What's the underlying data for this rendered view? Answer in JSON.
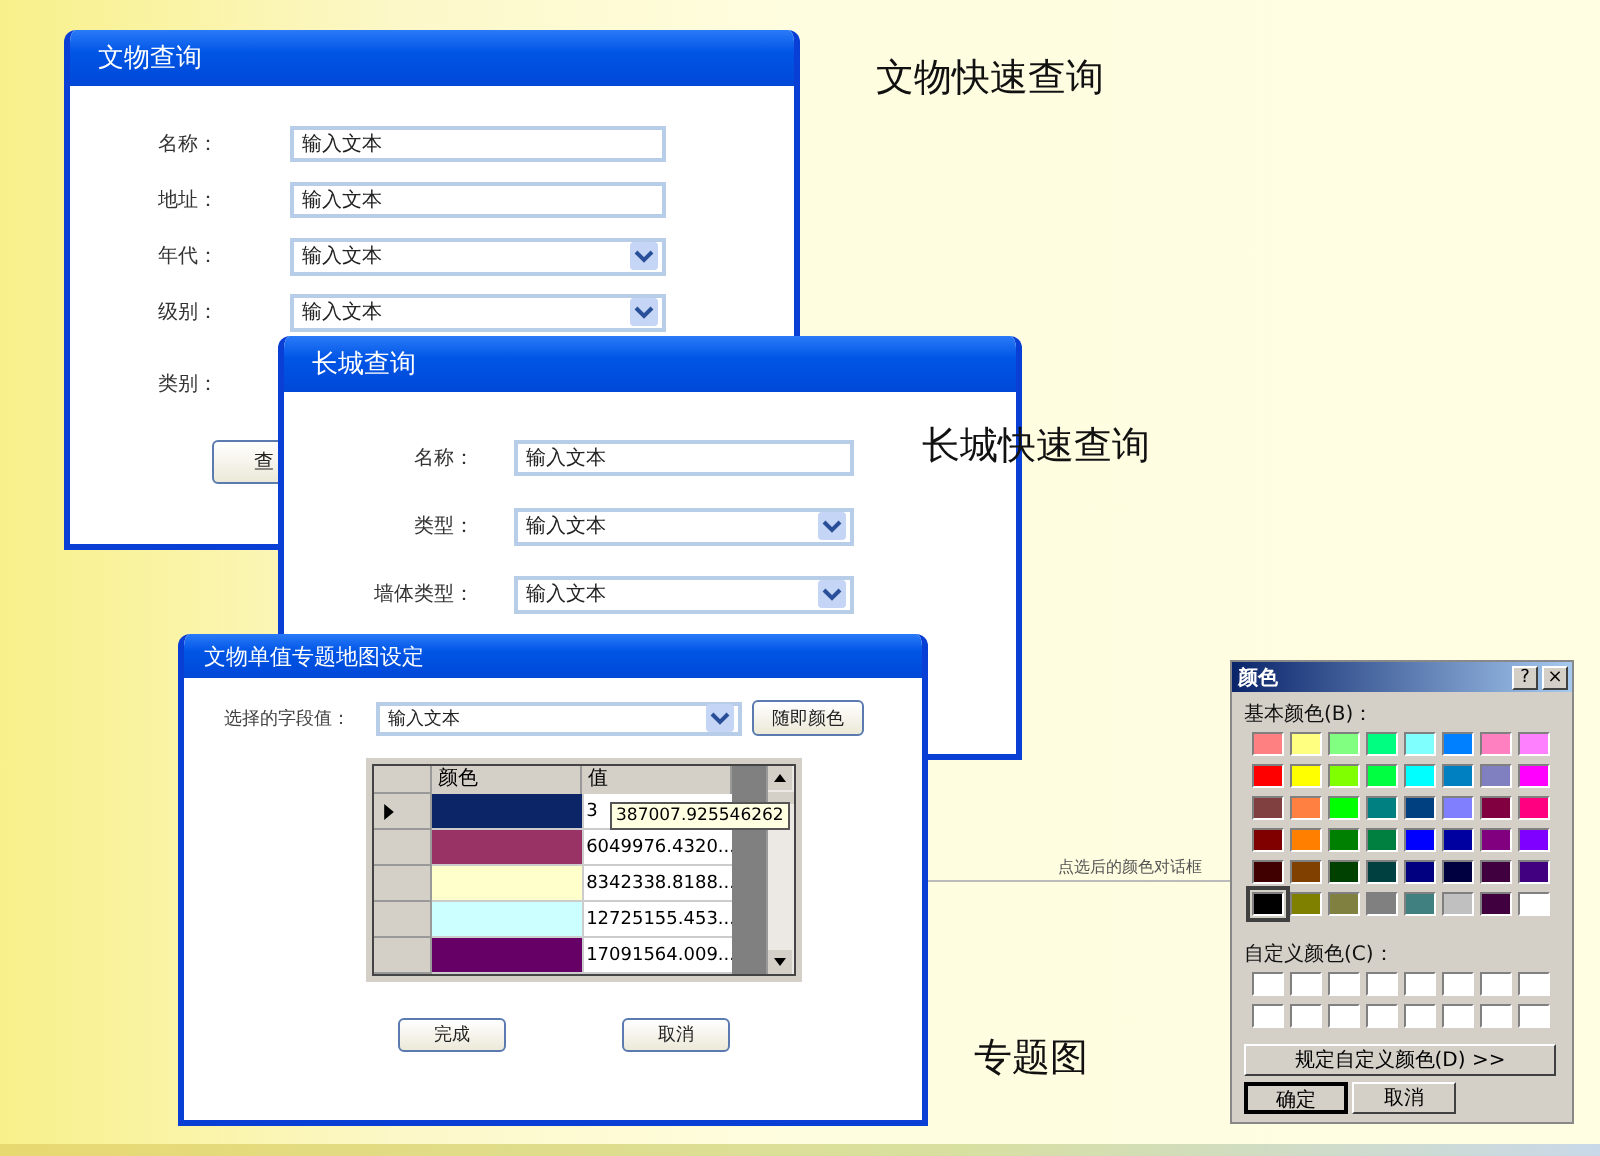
{
  "captions": [
    "文物快速查询",
    "长城快速查询",
    "专题图"
  ],
  "relic_query": {
    "title": "文物查询",
    "fields": [
      {
        "label": "名称：",
        "kind": "text",
        "placeholder": "输入文本"
      },
      {
        "label": "地址：",
        "kind": "text",
        "placeholder": "输入文本"
      },
      {
        "label": "年代：",
        "kind": "dropdown",
        "value": "输入文本"
      },
      {
        "label": "级别：",
        "kind": "dropdown",
        "value": "输入文本"
      },
      {
        "label": "类别：",
        "kind": "label"
      }
    ],
    "button": "查"
  },
  "wall_query": {
    "title": "长城查询",
    "fields": [
      {
        "label": "名称：",
        "kind": "text",
        "placeholder": "输入文本"
      },
      {
        "label": "类型：",
        "kind": "dropdown",
        "value": "输入文本"
      },
      {
        "label": "墙体类型：",
        "kind": "dropdown",
        "value": "输入文本"
      }
    ]
  },
  "theme_map": {
    "title": "文物单值专题地图设定",
    "field_label": "选择的字段值：",
    "field_value": "输入文本",
    "random_button": "随即颜色",
    "grid": {
      "columns": [
        "颜色",
        "值"
      ],
      "rows": [
        {
          "color": "#0b2566",
          "value": "3",
          "current": true
        },
        {
          "color": "#993366",
          "value": "6049976.4320...",
          "current": false
        },
        {
          "color": "#ffffcc",
          "value": "8342338.8188...",
          "current": false
        },
        {
          "color": "#ccffff",
          "value": "12725155.453...",
          "current": false
        },
        {
          "color": "#660066",
          "value": "17091564.009...",
          "current": false
        }
      ],
      "tooltip": "387007.925546262"
    },
    "buttons": [
      "完成",
      "取消"
    ]
  },
  "connector_label": "点选后的颜色对话框",
  "color_dialog": {
    "title": "颜色",
    "help": "?",
    "close": "×",
    "basic_label": "基本颜色(B)：",
    "basic_colors": [
      {
        "color": "#ff8080",
        "selected": false
      },
      {
        "color": "#ffff80",
        "selected": false
      },
      {
        "color": "#80ff80",
        "selected": false
      },
      {
        "color": "#00ff80",
        "selected": false
      },
      {
        "color": "#80ffff",
        "selected": false
      },
      {
        "color": "#0080ff",
        "selected": false
      },
      {
        "color": "#ff80c0",
        "selected": false
      },
      {
        "color": "#ff80ff",
        "selected": false
      },
      {
        "color": "#ff0000",
        "selected": false
      },
      {
        "color": "#ffff00",
        "selected": false
      },
      {
        "color": "#80ff00",
        "selected": false
      },
      {
        "color": "#00ff40",
        "selected": false
      },
      {
        "color": "#00ffff",
        "selected": false
      },
      {
        "color": "#0080c0",
        "selected": false
      },
      {
        "color": "#8080c0",
        "selected": false
      },
      {
        "color": "#ff00ff",
        "selected": false
      },
      {
        "color": "#804040",
        "selected": false
      },
      {
        "color": "#ff8040",
        "selected": false
      },
      {
        "color": "#00ff00",
        "selected": false
      },
      {
        "color": "#008080",
        "selected": false
      },
      {
        "color": "#004080",
        "selected": false
      },
      {
        "color": "#8080ff",
        "selected": false
      },
      {
        "color": "#800040",
        "selected": false
      },
      {
        "color": "#ff0080",
        "selected": false
      },
      {
        "color": "#800000",
        "selected": false
      },
      {
        "color": "#ff8000",
        "selected": false
      },
      {
        "color": "#008000",
        "selected": false
      },
      {
        "color": "#008040",
        "selected": false
      },
      {
        "color": "#0000ff",
        "selected": false
      },
      {
        "color": "#0000a0",
        "selected": false
      },
      {
        "color": "#800080",
        "selected": false
      },
      {
        "color": "#8000ff",
        "selected": false
      },
      {
        "color": "#400000",
        "selected": false
      },
      {
        "color": "#804000",
        "selected": false
      },
      {
        "color": "#004000",
        "selected": false
      },
      {
        "color": "#004040",
        "selected": false
      },
      {
        "color": "#000080",
        "selected": false
      },
      {
        "color": "#000040",
        "selected": false
      },
      {
        "color": "#400040",
        "selected": false
      },
      {
        "color": "#400080",
        "selected": false
      },
      {
        "color": "#000000",
        "selected": true
      },
      {
        "color": "#808000",
        "selected": false
      },
      {
        "color": "#808040",
        "selected": false
      },
      {
        "color": "#808080",
        "selected": false
      },
      {
        "color": "#408080",
        "selected": false
      },
      {
        "color": "#c0c0c0",
        "selected": false
      },
      {
        "color": "#400040",
        "selected": false
      },
      {
        "color": "#ffffff",
        "selected": false
      }
    ],
    "custom_label": "自定义颜色(C)：",
    "define_button": "规定自定义颜色(D) >>",
    "ok_button": "确定",
    "cancel_button": "取消"
  }
}
